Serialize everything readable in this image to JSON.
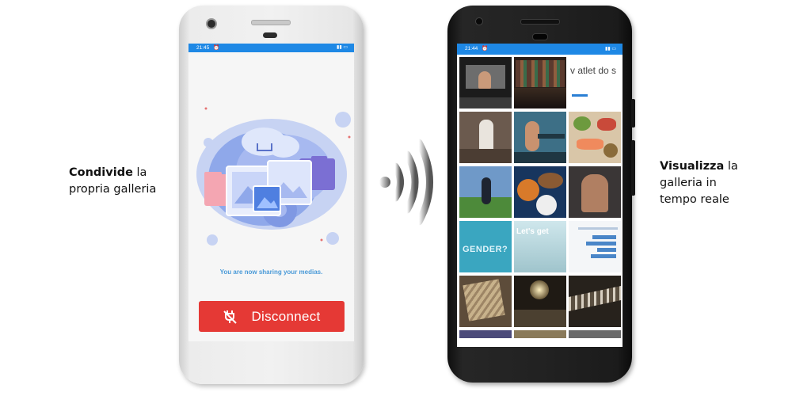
{
  "left_caption": {
    "bold": "Condivide",
    "rest1": "la",
    "rest2": "propria galleria"
  },
  "right_caption": {
    "bold": "Visualizza",
    "rest1": "la",
    "rest2": "galleria in",
    "rest3": "tempo reale"
  },
  "sender_phone": {
    "status_time": "21:45",
    "message": "You are now sharing your medias.",
    "disconnect_label": "Disconnect",
    "accent": "#e53935"
  },
  "receiver_phone": {
    "status_time": "21:44",
    "tile_texts": {
      "partial_title": "v atlet do s",
      "lets_get": "Let's get",
      "gender": "GENDER?"
    }
  },
  "colors": {
    "status_bar": "#1e88e5",
    "dark_phone": "#222222",
    "white_phone": "#efefef"
  },
  "icons": [
    "wifi-signal-icon",
    "unplug-icon",
    "gallery-illustration",
    "battery-icon",
    "alarm-icon"
  ]
}
